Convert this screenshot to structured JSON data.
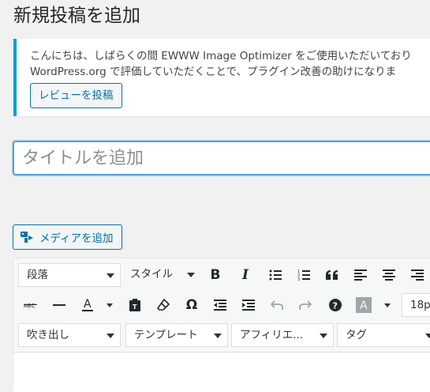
{
  "page": {
    "title": "新規投稿を追加"
  },
  "notice": {
    "line1": "こんにちは、しばらくの間 EWWW Image Optimizer をご使用いただいており",
    "line2": "WordPress.org で評価していただくことで、プラグイン改善の助けになりま",
    "review_button": "レビューを投稿"
  },
  "editor": {
    "title_placeholder": "タイトルを追加",
    "media_button": "メディアを追加",
    "toolbar": {
      "format_select": "段落",
      "style_select": "スタイル",
      "font_size": "18p",
      "row3": [
        "吹き出し",
        "テンプレート",
        "アフィリエ...",
        "タグ"
      ]
    }
  },
  "colors": {
    "accent": "#0073aa",
    "notice_border": "#00a0d2",
    "focus": "#5b9dd9"
  }
}
